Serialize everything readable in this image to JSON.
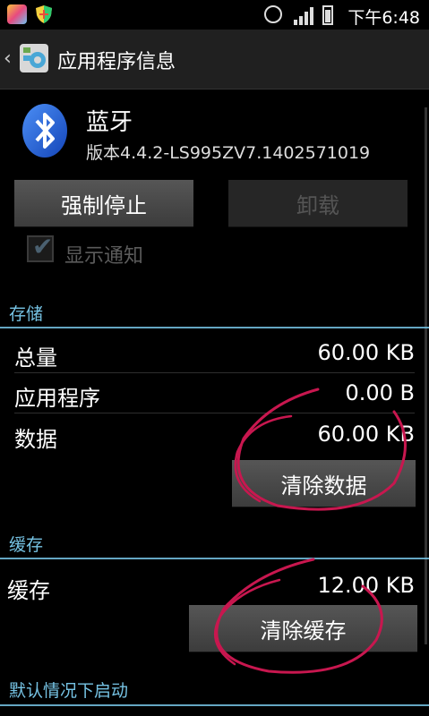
{
  "status_bar": {
    "time": "下午6:48",
    "icons": [
      "app-store-icon",
      "security-shield-icon",
      "alarm-clock-icon",
      "signal-icon",
      "battery-icon"
    ]
  },
  "header": {
    "title": "应用程序信息",
    "back_icon": "back-arrow-icon",
    "app_icon": "settings-icon"
  },
  "app": {
    "name": "蓝牙",
    "version": "版本4.4.2-LS995ZV7.1402571019",
    "icon": "bluetooth-icon"
  },
  "buttons": {
    "force_stop": "强制停止",
    "uninstall": "卸载"
  },
  "notification": {
    "label": "显示通知",
    "checked": true,
    "enabled": false
  },
  "storage": {
    "section_title": "存储",
    "rows": [
      {
        "label": "总量",
        "value": "60.00 KB"
      },
      {
        "label": "应用程序",
        "value": "0.00 B"
      },
      {
        "label": "数据",
        "value": "60.00 KB"
      }
    ],
    "clear_data": "清除数据"
  },
  "cache": {
    "section_title": "缓存",
    "label": "缓存",
    "value": "12.00 KB",
    "clear_cache": "清除缓存"
  },
  "launch_default": {
    "section_title": "默认情况下启动"
  },
  "colors": {
    "accent": "#76c3e4",
    "annotation": "#c8174f"
  }
}
